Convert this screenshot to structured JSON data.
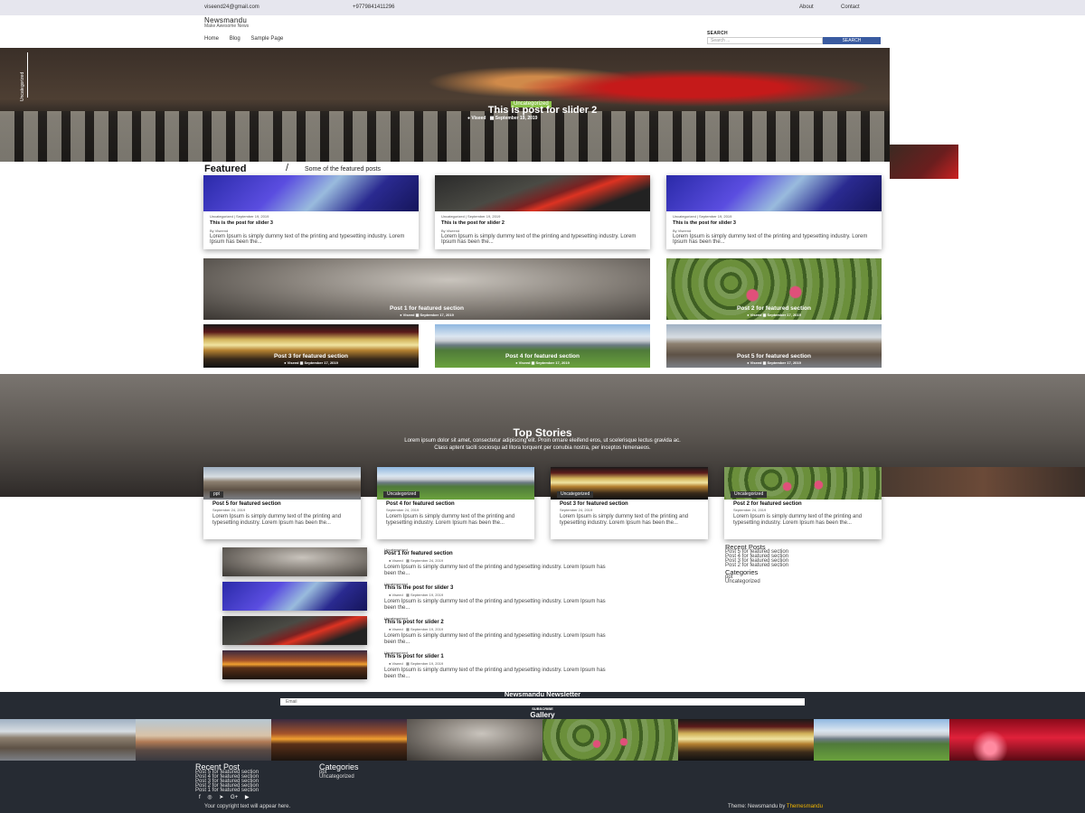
{
  "topbar": {
    "email": "viseend24@gmail.com",
    "phone": "+9779841411296",
    "links": [
      "About",
      "Contact"
    ]
  },
  "header": {
    "site_title": "Newsmandu",
    "tagline": "Make Awesome News",
    "nav": [
      "Home",
      "Blog",
      "Sample Page"
    ],
    "search_label": "SEARCH",
    "search_placeholder": "Search ...",
    "search_button": "SEARCH"
  },
  "hero": {
    "side_label": "Uncategorized",
    "badge": "Uncategorized",
    "title": "This is post for slider 2",
    "author": "Viseed",
    "date": "September 19, 2019"
  },
  "featured": {
    "heading": "Featured",
    "slash": "/",
    "subheading": "Some of the featured posts",
    "cards": [
      {
        "meta": "Uncategorized | September 19, 2019",
        "title": "This is the post for slider 3",
        "by": "By Viseend",
        "excerpt": "Lorem Ipsum is simply dummy text of the printing and typesetting industry. Lorem Ipsum has been the..."
      },
      {
        "meta": "Uncategorized | September 19, 2019",
        "title": "This is the post for slider 2",
        "by": "By Viseend",
        "excerpt": "Lorem Ipsum is simply dummy text of the printing and typesetting industry. Lorem Ipsum has been the..."
      },
      {
        "meta": "Uncategorized | September 19, 2019",
        "title": "This is the post for slider 3",
        "by": "By Viseend",
        "excerpt": "Lorem Ipsum is simply dummy text of the printing and typesetting industry. Lorem Ipsum has been the..."
      }
    ],
    "tiles": [
      {
        "title": "Post 1 for featured section",
        "author": "Viseed",
        "date": "September 17, 2019"
      },
      {
        "title": "Post 2 for featured section",
        "author": "Viseed",
        "date": "September 17, 2019"
      },
      {
        "title": "Post 3 for featured section",
        "author": "Viseed",
        "date": "September 17, 2019"
      },
      {
        "title": "Post 4 for featured section",
        "author": "Viseed",
        "date": "September 17, 2019"
      },
      {
        "title": "Post 5 for featured section",
        "author": "Viseed",
        "date": "September 17, 2019"
      }
    ]
  },
  "top_stories": {
    "title": "Top Stories",
    "desc1": "Lorem ipsum dolor sit amet, consectetur adipiscing elit. Proin ornare eleifend eros, ut scelerisque lectus gravida ac.",
    "desc2": "Class aptent taciti sociosqu ad litora torquent per conubia nostra, per inceptos himenaeos.",
    "cards": [
      {
        "badge": "ppt",
        "title": "Post 5 for featured section",
        "date": "September 24, 2019",
        "excerpt": "Lorem Ipsum is simply dummy text of the printing and typesetting industry. Lorem Ipsum has been the..."
      },
      {
        "badge": "Uncategorized",
        "title": "Post 4 for featured section",
        "date": "September 24, 2019",
        "excerpt": "Lorem Ipsum is simply dummy text of the printing and typesetting industry. Lorem Ipsum has been the..."
      },
      {
        "badge": "Uncategorized",
        "title": "Post 3 for featured section",
        "date": "September 24, 2019",
        "excerpt": "Lorem Ipsum is simply dummy text of the printing and typesetting industry. Lorem Ipsum has been the..."
      },
      {
        "badge": "Uncategorized",
        "title": "Post 2 for featured section",
        "date": "September 24, 2019",
        "excerpt": "Lorem Ipsum is simply dummy text of the printing and typesetting industry. Lorem Ipsum has been the..."
      }
    ]
  },
  "list": [
    {
      "cat": "Uncategorized",
      "title": "Post 1 for featured section",
      "author": "Viseed",
      "date": "September 24, 2019",
      "excerpt": "Lorem Ipsum is simply dummy text of the printing and typesetting industry. Lorem Ipsum has been the..."
    },
    {
      "cat": "Uncategorized",
      "title": "This is the post for slider 3",
      "author": "Viseed",
      "date": "September 19, 2019",
      "excerpt": "Lorem Ipsum is simply dummy text of the printing and typesetting industry. Lorem Ipsum has been the..."
    },
    {
      "cat": "Uncategorized",
      "title": "This is post for slider 2",
      "author": "Viseed",
      "date": "September 19, 2019",
      "excerpt": "Lorem Ipsum is simply dummy text of the printing and typesetting industry. Lorem Ipsum has been the..."
    },
    {
      "cat": "Uncategorized",
      "title": "This is post for slider 1",
      "author": "Viseed",
      "date": "September 19, 2019",
      "excerpt": "Lorem Ipsum is simply dummy text of the printing and typesetting industry. Lorem Ipsum has been the..."
    }
  ],
  "sidebar": {
    "recent_title": "Recent Posts",
    "recent": [
      "Post 5 for featured section",
      "Post 4 for featured section",
      "Post 3 for featured section",
      "Post 2 for featured section"
    ],
    "cat_title": "Categories",
    "cats": [
      "ppt",
      "Uncategorized"
    ]
  },
  "newsletter": {
    "title": "Newsmandu Newsletter",
    "placeholder": "Email",
    "button": "SUBSCRIBE"
  },
  "gallery": {
    "title": "Gallery"
  },
  "footer": {
    "recent_title": "Recent Post",
    "recent": [
      "Post 5 for featured section",
      "Post 4 for featured section",
      "Post 3 for featured section",
      "Post 2 for featured section",
      "Post 1 for featured section"
    ],
    "cat_title": "Categories",
    "cats": [
      "ppt",
      "Uncategorized"
    ],
    "social_icons": [
      "facebook-icon",
      "instagram-icon",
      "twitter-icon",
      "google-plus-icon",
      "youtube-icon"
    ],
    "copyright": "Your copyright text will appear here.",
    "theme_prefix": "Theme: Newsmandu by ",
    "theme_link": "Themesmandu"
  },
  "colors": {
    "accent": "#3a5ba0",
    "badge_green": "#8bc34a",
    "footer_bg": "#262b33",
    "link_yellow": "#f0b400"
  }
}
